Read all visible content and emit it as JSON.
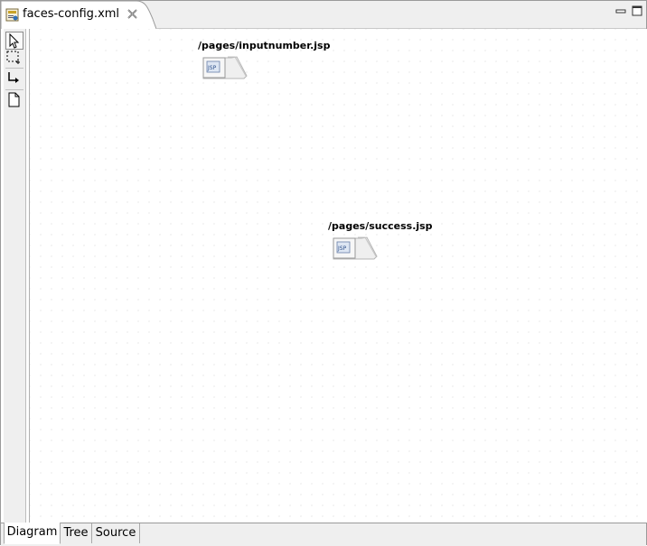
{
  "editor": {
    "tab_title": "faces-config.xml",
    "tab_icon": "faces-config-file-icon",
    "close_icon": "close-icon",
    "window_buttons": [
      "minimize-icon",
      "maximize-icon"
    ]
  },
  "palette": {
    "tools": [
      {
        "name": "select-tool",
        "icon": "arrow-pointer-icon",
        "selected": true
      },
      {
        "name": "marquee-tool",
        "icon": "dashed-marquee-icon",
        "selected": false
      },
      {
        "name": "connection-tool",
        "icon": "connection-arrow-icon",
        "selected": false
      },
      {
        "name": "page-tool",
        "icon": "page-icon",
        "selected": false
      }
    ]
  },
  "diagram": {
    "nodes": [
      {
        "label": "/pages/inputnumber.jsp",
        "icon": "jsp-page-icon"
      },
      {
        "label": "/pages/success.jsp",
        "icon": "jsp-page-icon"
      }
    ]
  },
  "bottom_tabs": [
    {
      "label": "Diagram",
      "active": true
    },
    {
      "label": "Tree",
      "active": false
    },
    {
      "label": "Source",
      "active": false
    }
  ]
}
